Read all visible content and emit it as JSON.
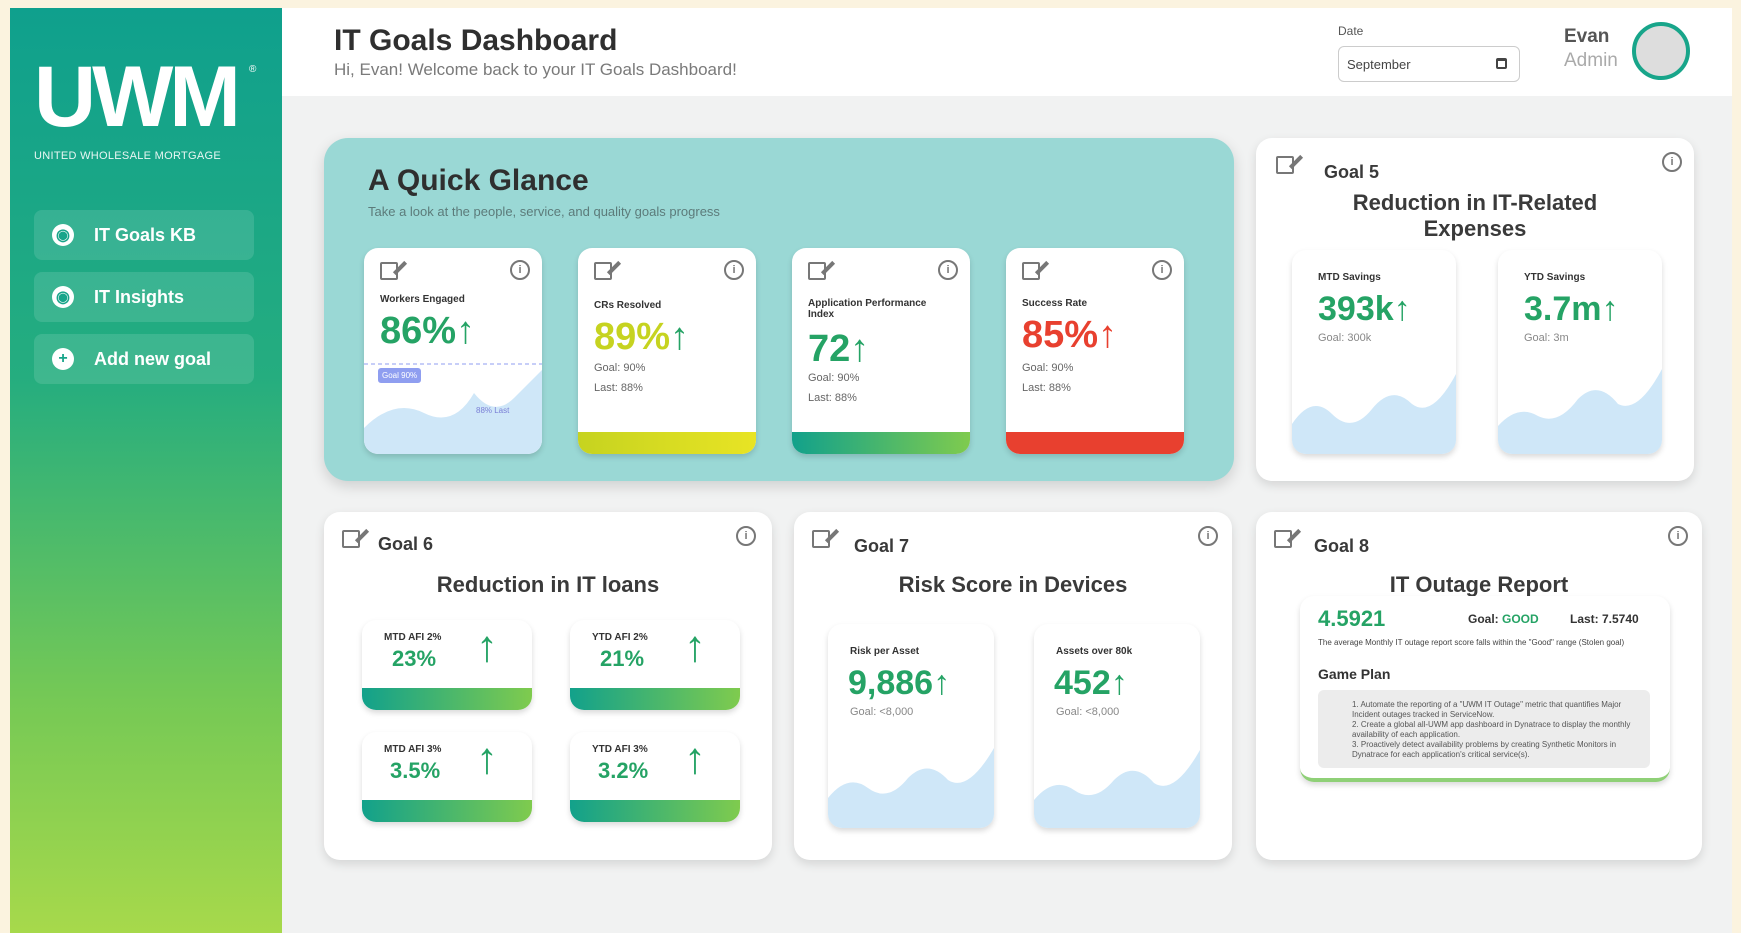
{
  "brand": {
    "logo": "UWM",
    "reg": "®",
    "subtitle": "UNITED WHOLESALE MORTGAGE"
  },
  "colors": {
    "teal": "#18a58a",
    "green": "#25a365",
    "yellow": "#c6d320",
    "red": "#e8402f",
    "glance_bg": "#9ad8d5"
  },
  "sidebar": {
    "items": [
      {
        "label": "IT Goals KB",
        "icon": "globe-icon"
      },
      {
        "label": "IT Insights",
        "icon": "globe-icon"
      },
      {
        "label": "Add new goal",
        "icon": "plus-circle-icon"
      }
    ]
  },
  "header": {
    "title": "IT Goals Dashboard",
    "subtitle": "Hi, Evan! Welcome back to your IT Goals Dashboard!",
    "date_label": "Date",
    "date_value": "September",
    "user_name": "Evan",
    "user_role": "Admin"
  },
  "glance": {
    "title": "A Quick Glance",
    "subtitle": "Take a look at the people, service, and quality goals progress",
    "cards": [
      {
        "label": "Workers Engaged",
        "value": "86%",
        "arrow": "↑",
        "badge": "Goal 90%",
        "last_label": "88% Last"
      },
      {
        "label": "CRs Resolved",
        "value": "89%",
        "arrow": "↑",
        "goal": "Goal: 90%",
        "last": "Last: 88%"
      },
      {
        "label": "Application Performance Index",
        "value": "72",
        "arrow": "↑",
        "goal": "Goal: 90%",
        "last": "Last: 88%"
      },
      {
        "label": "Success Rate",
        "value": "85%",
        "arrow": "↑",
        "goal": "Goal: 90%",
        "last": "Last: 88%"
      }
    ]
  },
  "goal5": {
    "head": "Goal 5",
    "title": "Reduction in IT-Related Expenses",
    "cards": [
      {
        "label": "MTD Savings",
        "value": "393k",
        "arrow": "↑",
        "goal": "Goal: 300k"
      },
      {
        "label": "YTD Savings",
        "value": "3.7m",
        "arrow": "↑",
        "goal": "Goal: 3m"
      }
    ]
  },
  "goal6": {
    "head": "Goal 6",
    "title": "Reduction in IT loans",
    "cards": [
      {
        "label": "MTD AFI 2%",
        "value": "23%",
        "arrow": "↑"
      },
      {
        "label": "YTD AFI 2%",
        "value": "21%",
        "arrow": "↑"
      },
      {
        "label": "MTD AFI 3%",
        "value": "3.5%",
        "arrow": "↑"
      },
      {
        "label": "YTD AFI 3%",
        "value": "3.2%",
        "arrow": "↑"
      }
    ]
  },
  "goal7": {
    "head": "Goal 7",
    "title": "Risk Score in Devices",
    "cards": [
      {
        "label": "Risk per Asset",
        "value": "9,886",
        "arrow": "↑",
        "goal": "Goal: <8,000"
      },
      {
        "label": "Assets over 80k",
        "value": "452",
        "arrow": "↑",
        "goal": "Goal: <8,000"
      }
    ]
  },
  "goal8": {
    "head": "Goal 8",
    "title": "IT Outage Report",
    "score": "4.5921",
    "goal_label": "Goal:",
    "goal_value": "GOOD",
    "last": "Last: 7.5740",
    "desc": "The average Monthly IT outage report score falls within the \"Good\" range (Stolen goal)",
    "plan_title": "Game Plan",
    "plan": [
      "1. Automate the reporting of a \"UWM IT Outage\" metric that quantifies Major Incident outages tracked in ServiceNow.",
      "2. Create a global all-UWM app dashboard in Dynatrace to display the monthly availability of each application.",
      "3. Proactively detect availability problems by creating Synthetic Monitors in Dynatrace for each application's critical service(s)."
    ]
  }
}
